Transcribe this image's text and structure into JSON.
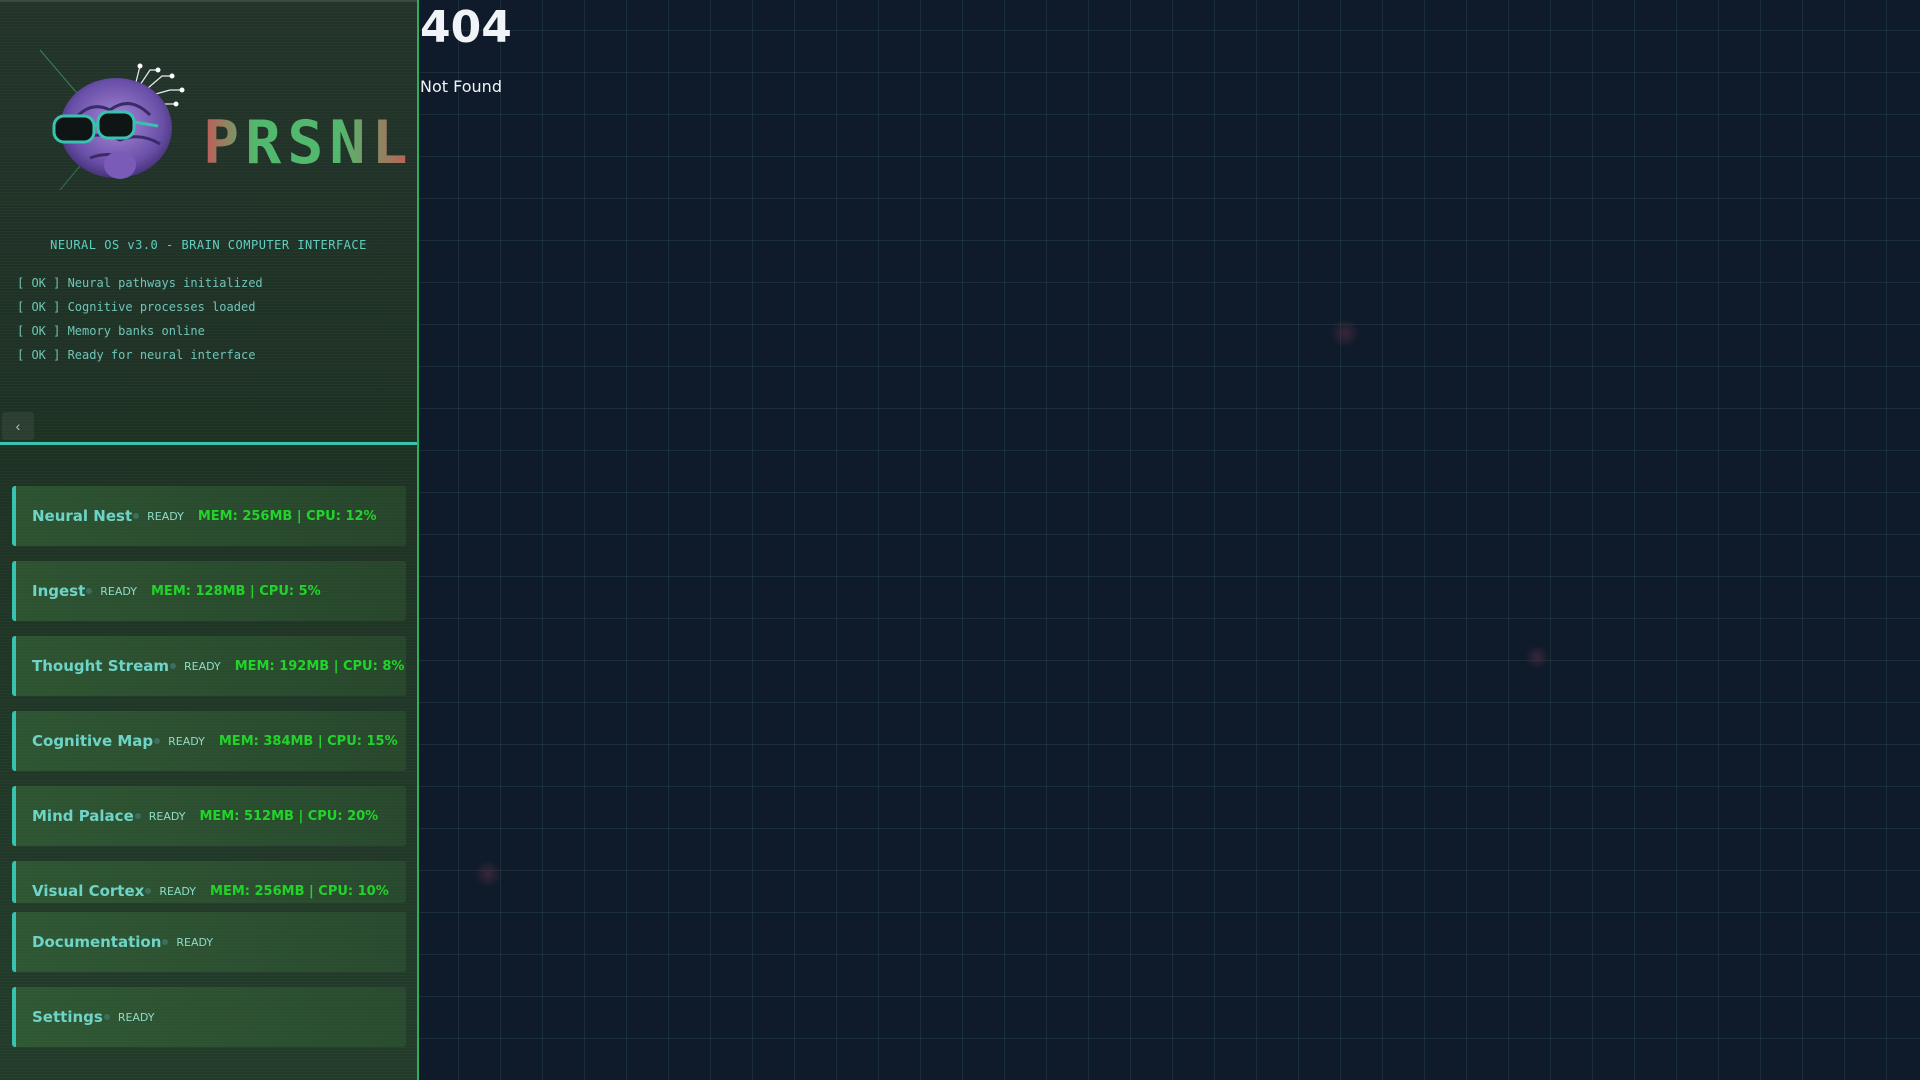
{
  "brand": {
    "logo_text": "PRSNL",
    "system_title": "NEURAL OS v3.0 - BRAIN COMPUTER INTERFACE"
  },
  "boot_log": [
    "[ OK ] Neural pathways initialized",
    "[ OK ] Cognitive processes loaded",
    "[ OK ] Memory banks online",
    "[ OK ] Ready for neural interface"
  ],
  "collapse_icon": "‹",
  "nav": {
    "items": [
      {
        "label": "Neural Nest",
        "status": "READY",
        "metrics": "MEM: 256MB | CPU: 12%"
      },
      {
        "label": "Ingest",
        "status": "READY",
        "metrics": "MEM: 128MB | CPU: 5%"
      },
      {
        "label": "Thought Stream",
        "status": "READY",
        "metrics": "MEM: 192MB | CPU: 8%"
      },
      {
        "label": "Cognitive Map",
        "status": "READY",
        "metrics": "MEM: 384MB | CPU: 15%"
      },
      {
        "label": "Mind Palace",
        "status": "READY",
        "metrics": "MEM: 512MB | CPU: 20%"
      },
      {
        "label": "Visual Cortex",
        "status": "READY",
        "metrics": "MEM: 256MB | CPU: 10%"
      },
      {
        "label": "Documentation",
        "status": "READY",
        "metrics": ""
      },
      {
        "label": "Settings",
        "status": "READY",
        "metrics": ""
      }
    ]
  },
  "main": {
    "error_code": "404",
    "error_message": "Not Found"
  },
  "colors": {
    "accent": "#39c2b0",
    "metric_green": "#22d42a",
    "background": "#0f1a2a"
  }
}
